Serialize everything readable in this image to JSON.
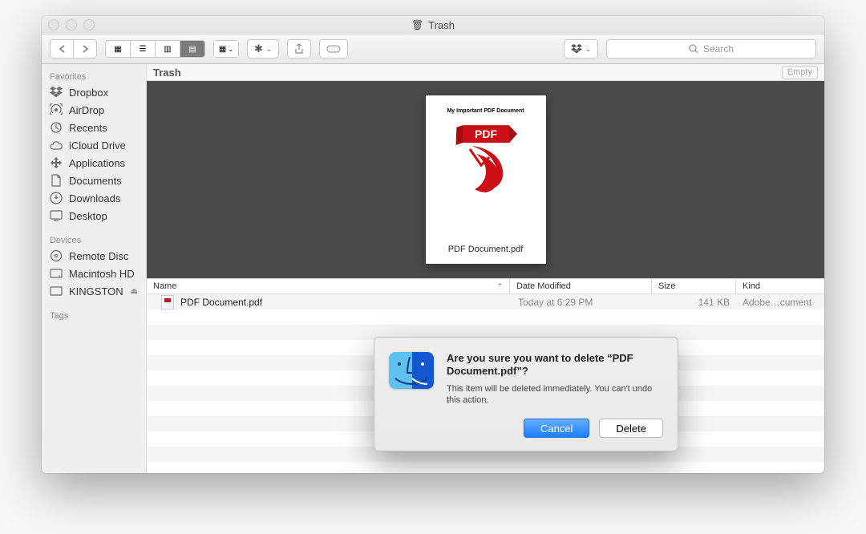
{
  "window": {
    "title": "Trash"
  },
  "toolbar": {
    "search_placeholder": "Search"
  },
  "location": {
    "name": "Trash",
    "empty_label": "Empty"
  },
  "sidebar": {
    "sections": [
      {
        "title": "Favorites",
        "items": [
          {
            "icon": "dropbox",
            "label": "Dropbox"
          },
          {
            "icon": "airdrop",
            "label": "AirDrop"
          },
          {
            "icon": "clock",
            "label": "Recents"
          },
          {
            "icon": "cloud",
            "label": "iCloud Drive"
          },
          {
            "icon": "apps",
            "label": "Applications"
          },
          {
            "icon": "doc",
            "label": "Documents"
          },
          {
            "icon": "download",
            "label": "Downloads"
          },
          {
            "icon": "desktop",
            "label": "Desktop"
          }
        ]
      },
      {
        "title": "Devices",
        "items": [
          {
            "icon": "disc",
            "label": "Remote Disc"
          },
          {
            "icon": "hdd",
            "label": "Macintosh HD"
          },
          {
            "icon": "usb",
            "label": "KINGSTON",
            "eject": true
          }
        ]
      },
      {
        "title": "Tags",
        "items": []
      }
    ]
  },
  "preview": {
    "doc_title": "My Important PDF Document",
    "badge_text": "PDF",
    "caption": "PDF Document.pdf"
  },
  "columns": {
    "name": "Name",
    "modified": "Date Modified",
    "size": "Size",
    "kind": "Kind"
  },
  "files": [
    {
      "name": "PDF Document.pdf",
      "modified": "Today at 6:29 PM",
      "size": "141 KB",
      "kind": "Adobe…cument"
    }
  ],
  "dialog": {
    "title": "Are you sure you want to delete “PDF Document.pdf”?",
    "description": "This item will be deleted immediately. You can't undo this action.",
    "cancel": "Cancel",
    "confirm": "Delete"
  }
}
